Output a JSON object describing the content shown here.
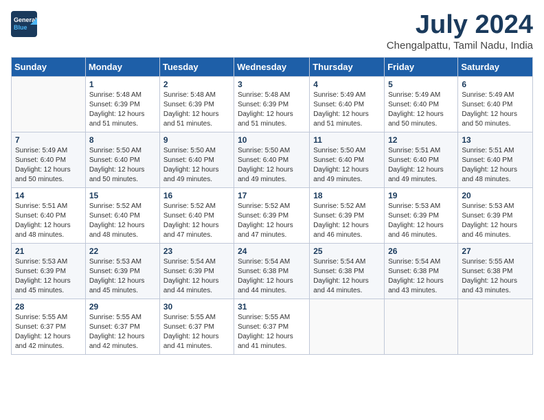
{
  "header": {
    "logo_line1": "General",
    "logo_line2": "Blue",
    "month": "July 2024",
    "location": "Chengalpattu, Tamil Nadu, India"
  },
  "days_of_week": [
    "Sunday",
    "Monday",
    "Tuesday",
    "Wednesday",
    "Thursday",
    "Friday",
    "Saturday"
  ],
  "weeks": [
    [
      {
        "day": "",
        "info": ""
      },
      {
        "day": "1",
        "info": "Sunrise: 5:48 AM\nSunset: 6:39 PM\nDaylight: 12 hours\nand 51 minutes."
      },
      {
        "day": "2",
        "info": "Sunrise: 5:48 AM\nSunset: 6:39 PM\nDaylight: 12 hours\nand 51 minutes."
      },
      {
        "day": "3",
        "info": "Sunrise: 5:48 AM\nSunset: 6:39 PM\nDaylight: 12 hours\nand 51 minutes."
      },
      {
        "day": "4",
        "info": "Sunrise: 5:49 AM\nSunset: 6:40 PM\nDaylight: 12 hours\nand 51 minutes."
      },
      {
        "day": "5",
        "info": "Sunrise: 5:49 AM\nSunset: 6:40 PM\nDaylight: 12 hours\nand 50 minutes."
      },
      {
        "day": "6",
        "info": "Sunrise: 5:49 AM\nSunset: 6:40 PM\nDaylight: 12 hours\nand 50 minutes."
      }
    ],
    [
      {
        "day": "7",
        "info": "Sunrise: 5:49 AM\nSunset: 6:40 PM\nDaylight: 12 hours\nand 50 minutes."
      },
      {
        "day": "8",
        "info": "Sunrise: 5:50 AM\nSunset: 6:40 PM\nDaylight: 12 hours\nand 50 minutes."
      },
      {
        "day": "9",
        "info": "Sunrise: 5:50 AM\nSunset: 6:40 PM\nDaylight: 12 hours\nand 49 minutes."
      },
      {
        "day": "10",
        "info": "Sunrise: 5:50 AM\nSunset: 6:40 PM\nDaylight: 12 hours\nand 49 minutes."
      },
      {
        "day": "11",
        "info": "Sunrise: 5:50 AM\nSunset: 6:40 PM\nDaylight: 12 hours\nand 49 minutes."
      },
      {
        "day": "12",
        "info": "Sunrise: 5:51 AM\nSunset: 6:40 PM\nDaylight: 12 hours\nand 49 minutes."
      },
      {
        "day": "13",
        "info": "Sunrise: 5:51 AM\nSunset: 6:40 PM\nDaylight: 12 hours\nand 48 minutes."
      }
    ],
    [
      {
        "day": "14",
        "info": "Sunrise: 5:51 AM\nSunset: 6:40 PM\nDaylight: 12 hours\nand 48 minutes."
      },
      {
        "day": "15",
        "info": "Sunrise: 5:52 AM\nSunset: 6:40 PM\nDaylight: 12 hours\nand 48 minutes."
      },
      {
        "day": "16",
        "info": "Sunrise: 5:52 AM\nSunset: 6:40 PM\nDaylight: 12 hours\nand 47 minutes."
      },
      {
        "day": "17",
        "info": "Sunrise: 5:52 AM\nSunset: 6:39 PM\nDaylight: 12 hours\nand 47 minutes."
      },
      {
        "day": "18",
        "info": "Sunrise: 5:52 AM\nSunset: 6:39 PM\nDaylight: 12 hours\nand 46 minutes."
      },
      {
        "day": "19",
        "info": "Sunrise: 5:53 AM\nSunset: 6:39 PM\nDaylight: 12 hours\nand 46 minutes."
      },
      {
        "day": "20",
        "info": "Sunrise: 5:53 AM\nSunset: 6:39 PM\nDaylight: 12 hours\nand 46 minutes."
      }
    ],
    [
      {
        "day": "21",
        "info": "Sunrise: 5:53 AM\nSunset: 6:39 PM\nDaylight: 12 hours\nand 45 minutes."
      },
      {
        "day": "22",
        "info": "Sunrise: 5:53 AM\nSunset: 6:39 PM\nDaylight: 12 hours\nand 45 minutes."
      },
      {
        "day": "23",
        "info": "Sunrise: 5:54 AM\nSunset: 6:39 PM\nDaylight: 12 hours\nand 44 minutes."
      },
      {
        "day": "24",
        "info": "Sunrise: 5:54 AM\nSunset: 6:38 PM\nDaylight: 12 hours\nand 44 minutes."
      },
      {
        "day": "25",
        "info": "Sunrise: 5:54 AM\nSunset: 6:38 PM\nDaylight: 12 hours\nand 44 minutes."
      },
      {
        "day": "26",
        "info": "Sunrise: 5:54 AM\nSunset: 6:38 PM\nDaylight: 12 hours\nand 43 minutes."
      },
      {
        "day": "27",
        "info": "Sunrise: 5:55 AM\nSunset: 6:38 PM\nDaylight: 12 hours\nand 43 minutes."
      }
    ],
    [
      {
        "day": "28",
        "info": "Sunrise: 5:55 AM\nSunset: 6:37 PM\nDaylight: 12 hours\nand 42 minutes."
      },
      {
        "day": "29",
        "info": "Sunrise: 5:55 AM\nSunset: 6:37 PM\nDaylight: 12 hours\nand 42 minutes."
      },
      {
        "day": "30",
        "info": "Sunrise: 5:55 AM\nSunset: 6:37 PM\nDaylight: 12 hours\nand 41 minutes."
      },
      {
        "day": "31",
        "info": "Sunrise: 5:55 AM\nSunset: 6:37 PM\nDaylight: 12 hours\nand 41 minutes."
      },
      {
        "day": "",
        "info": ""
      },
      {
        "day": "",
        "info": ""
      },
      {
        "day": "",
        "info": ""
      }
    ]
  ]
}
